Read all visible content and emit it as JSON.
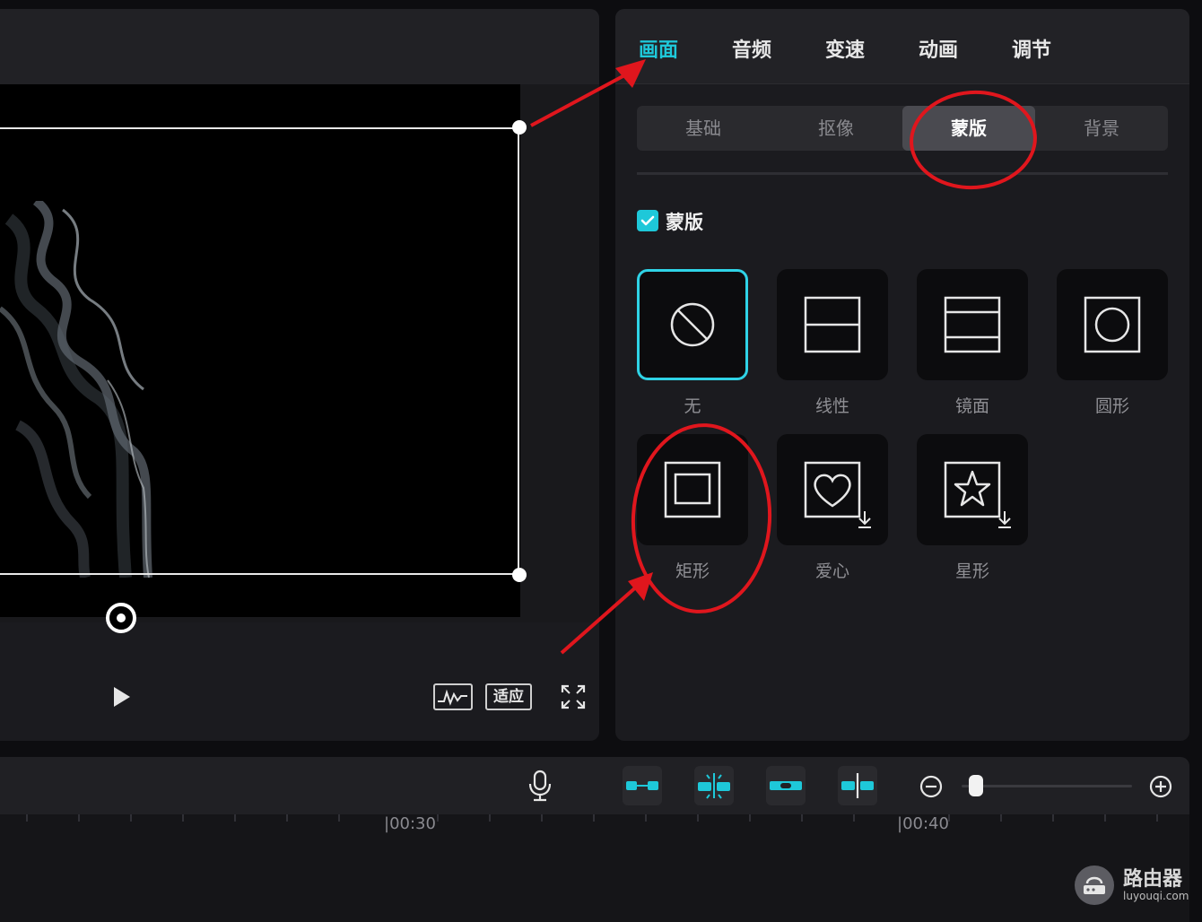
{
  "properties": {
    "tabs": [
      {
        "label": "画面",
        "active": true
      },
      {
        "label": "音频",
        "active": false
      },
      {
        "label": "变速",
        "active": false
      },
      {
        "label": "动画",
        "active": false
      },
      {
        "label": "调节",
        "active": false
      }
    ],
    "subtabs": [
      {
        "label": "基础",
        "active": false
      },
      {
        "label": "抠像",
        "active": false
      },
      {
        "label": "蒙版",
        "active": true
      },
      {
        "label": "背景",
        "active": false
      }
    ],
    "mask_toggle": {
      "label": "蒙版",
      "checked": true
    },
    "masks": [
      {
        "label": "无",
        "icon": "none-icon",
        "selected": true
      },
      {
        "label": "线性",
        "icon": "linear-mask-icon",
        "selected": false
      },
      {
        "label": "镜面",
        "icon": "mirror-mask-icon",
        "selected": false
      },
      {
        "label": "圆形",
        "icon": "circle-mask-icon",
        "selected": false
      },
      {
        "label": "矩形",
        "icon": "rectangle-mask-icon",
        "selected": false
      },
      {
        "label": "爱心",
        "icon": "heart-mask-icon",
        "selected": false,
        "download": true
      },
      {
        "label": "星形",
        "icon": "star-mask-icon",
        "selected": false,
        "download": true
      }
    ]
  },
  "preview": {
    "fit_label": "适应",
    "icons": [
      "play-icon",
      "waveform-icon",
      "fullscreen-icon"
    ]
  },
  "timeline": {
    "ticks": [
      "|00:30",
      "|00:40"
    ],
    "icons": [
      "microphone-icon",
      "link-clip-icon",
      "auto-snap-icon",
      "linkage-icon",
      "split-preview-icon",
      "zoom-out-icon",
      "zoom-in-icon"
    ]
  },
  "watermark": {
    "name": "路由器",
    "url": "luyouqi.com"
  },
  "colors": {
    "accent": "#1ec8d9",
    "annotation": "#e0161d",
    "panel": "#1b1b1f",
    "background": "#0d0d10"
  }
}
